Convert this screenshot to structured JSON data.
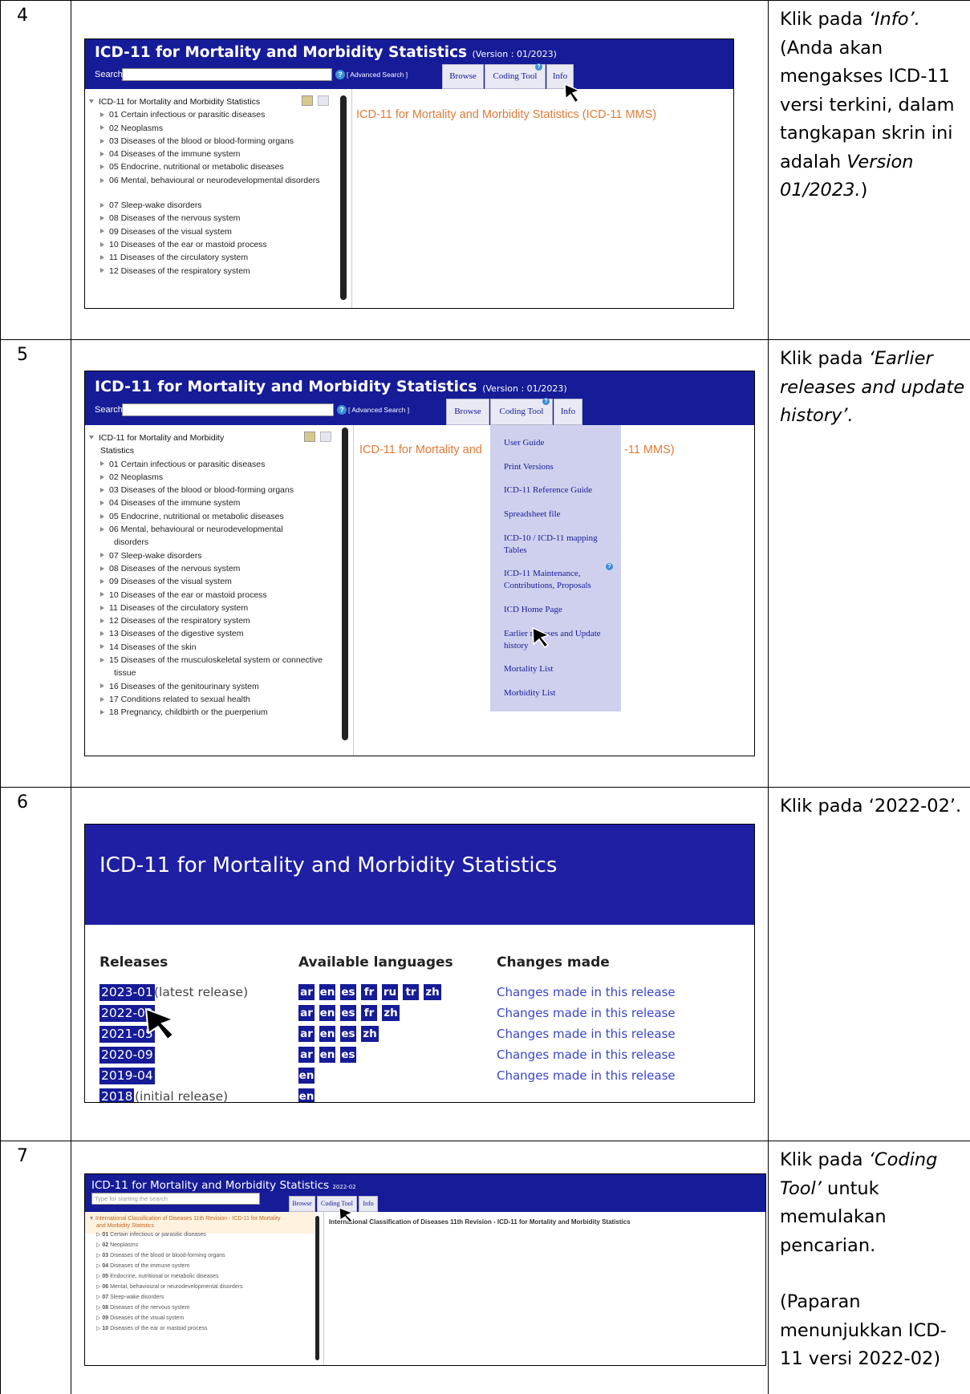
{
  "rows": [
    {
      "num": "4"
    },
    {
      "num": "5"
    },
    {
      "num": "6"
    },
    {
      "num": "7"
    }
  ],
  "desc": {
    "r4": {
      "a": "Klik pada ",
      "b": "‘Info’.",
      "c": "(Anda akan mengakses ICD-11 versi terkini, dalam tangkapan skrin ini adalah ",
      "d": "Version 01/2023.",
      "e": ")"
    },
    "r5": {
      "a": "Klik pada ",
      "b": "‘Earlier releases and update history’."
    },
    "r6": {
      "a": "Klik pada ‘2022-02’."
    },
    "r7": {
      "a": "Klik pada ",
      "b": "‘Coding Tool’",
      "c": " untuk memulakan pencarian.",
      "d": "(Paparan menunjukkan ICD-11 versi 2022-02)"
    }
  },
  "app": {
    "title": "ICD-11 for Mortality and Morbidity Statistics",
    "version": "(Version : 01/2023)",
    "search_label": "Search",
    "advanced": "[ Advanced Search ]",
    "tabs": {
      "browse": "Browse",
      "coding": "Coding Tool",
      "info": "Info"
    },
    "root": "ICD-11 for Mortality and Morbidity Statistics",
    "root_a": "ICD-11 for Mortality and Morbidity",
    "root_b": "Statistics",
    "main_title": "ICD-11 for Mortality and Morbidity Statistics (ICD-11 MMS)",
    "main_title_a": "ICD-11 for Mortality and",
    "main_title_b": "-11 MMS)"
  },
  "tree1": [
    "01 Certain infectious or parasitic diseases",
    "02 Neoplasms",
    "03 Diseases of the blood or blood-forming organs",
    "04 Diseases of the immune system",
    "05 Endocrine, nutritional or metabolic diseases",
    "06 Mental, behavioural or neurodevelopmental disorders",
    "07 Sleep-wake disorders",
    "08 Diseases of the nervous system",
    "09 Diseases of the visual system",
    "10 Diseases of the ear or mastoid process",
    "11 Diseases of the circulatory system",
    "12 Diseases of the respiratory system"
  ],
  "tree2": [
    "01 Certain infectious or parasitic diseases",
    "02 Neoplasms",
    "03 Diseases of the blood or blood-forming organs",
    "04 Diseases of the immune system",
    "05 Endocrine, nutritional or metabolic diseases",
    "06 Mental, behavioural or neurodevelopmental",
    "disorders",
    "07 Sleep-wake disorders",
    "08 Diseases of the nervous system",
    "09 Diseases of the visual system",
    "10 Diseases of the ear or mastoid process",
    "11 Diseases of the circulatory system",
    "12 Diseases of the respiratory system",
    "13 Diseases of the digestive system",
    "14 Diseases of the skin",
    "15 Diseases of the musculoskeletal system or connective",
    "tissue",
    "16 Diseases of the genitourinary system",
    "17 Conditions related to sexual health",
    "18 Pregnancy, childbirth or the puerperium"
  ],
  "info_menu": [
    "User Guide",
    "Print Versions",
    "ICD-11 Reference Guide",
    "Spreadsheet file",
    "ICD-10 / ICD-11 mapping",
    "Tables",
    "ICD-11 Maintenance,",
    "Contributions, Proposals",
    "ICD Home Page",
    "Earlier releases and Update",
    "history",
    "Mortality List",
    "Morbidity List"
  ],
  "releases_page": {
    "title": "ICD-11 for Mortality and Morbidity Statistics",
    "h_releases": "Releases",
    "h_languages": "Available languages",
    "h_changes": "Changes made",
    "releases": [
      {
        "ver": "2023-01",
        "note": "(latest release)",
        "langs": [
          "ar",
          "en",
          "es",
          "fr",
          "ru",
          "tr",
          "zh"
        ],
        "changes": "Changes made in this release"
      },
      {
        "ver": "2022-02",
        "note": "",
        "langs": [
          "ar",
          "en",
          "es",
          "fr",
          "zh"
        ],
        "changes": "Changes made in this release"
      },
      {
        "ver": "2021-05",
        "note": "",
        "langs": [
          "ar",
          "en",
          "es",
          "zh"
        ],
        "changes": "Changes made in this release"
      },
      {
        "ver": "2020-09",
        "note": "",
        "langs": [
          "ar",
          "en",
          "es"
        ],
        "changes": "Changes made in this release"
      },
      {
        "ver": "2019-04",
        "note": "",
        "langs": [
          "en"
        ],
        "changes": "Changes made in this release"
      },
      {
        "ver": "2018",
        "note": "(initial release)",
        "langs": [
          "en"
        ],
        "changes": ""
      }
    ]
  },
  "app7": {
    "title": "ICD-11 for Mortality and Morbidity Statistics",
    "version": "2022-02",
    "search_placeholder": "Type for starting the search",
    "root_a": "International Classification of Diseases 11th Revision - ICD-11 for Mortality",
    "root_b": "and Morbidity Statistics",
    "main_title": "International Classification of Diseases 11th Revision - ICD-11 for Mortality and Morbidity Statistics",
    "tree": [
      {
        "n": "01",
        "t": "Certain infectious or parasitic diseases"
      },
      {
        "n": "02",
        "t": "Neoplasms"
      },
      {
        "n": "03",
        "t": "Diseases of the blood or blood-forming organs"
      },
      {
        "n": "04",
        "t": "Diseases of the immune system"
      },
      {
        "n": "05",
        "t": "Endocrine, nutritional or metabolic diseases"
      },
      {
        "n": "06",
        "t": "Mental, behavioural or neurodevelopmental disorders"
      },
      {
        "n": "07",
        "t": "Sleep-wake disorders"
      },
      {
        "n": "08",
        "t": "Diseases of the nervous system"
      },
      {
        "n": "09",
        "t": "Diseases of the visual system"
      },
      {
        "n": "10",
        "t": "Diseases of the ear or mastoid process"
      }
    ]
  }
}
